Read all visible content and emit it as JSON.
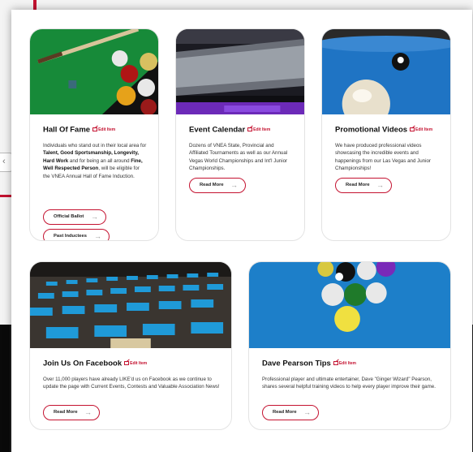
{
  "background": {
    "tab_glyph": "‹"
  },
  "cards": [
    {
      "title": "Hall Of Fame",
      "edit_label": "Edit Item",
      "text_parts": [
        {
          "t": "Individuals who stand out in their local area for ",
          "b": false
        },
        {
          "t": "Talent, Good Sportsmanship, Longevity, Hard Work",
          "b": true
        },
        {
          "t": " and for being an all around ",
          "b": false
        },
        {
          "t": "Fine, Well Respected Person",
          "b": true
        },
        {
          "t": ", will be eligible for the VNEA Annual Hall of Fame Induction.",
          "b": false
        }
      ],
      "buttons": [
        "Official Ballot",
        "Past Inductees"
      ]
    },
    {
      "title": "Event Calendar",
      "edit_label": "Edit Item",
      "text": "Dozens of VNEA State, Provincial and Affiliated Tournaments as well as our Annual Vegas World Championships and Int'l Junior Championships.",
      "buttons": [
        "Read More"
      ]
    },
    {
      "title": "Promotional Videos",
      "edit_label": "Edit Item",
      "text": "We have produced professional videos showcasing the incredible events and happenings from our Las Vegas and Junior Championships!",
      "buttons": [
        "Read More"
      ]
    },
    {
      "title": "Join Us On Facebook",
      "edit_label": "Edit Item",
      "text": "Over 11,000 players have already LIKE'd us on Facebook as we continue to update the page with Current Events, Contests and Valuable Association News!",
      "buttons": [
        "Read More"
      ]
    },
    {
      "title": "Dave Pearson Tips",
      "edit_label": "Edit Item",
      "text": "Professional player and ultimate entertainer, Dave \"Ginger Wizard\" Pearson, shares several helpful training videos to help every player improve their game.",
      "buttons": [
        "Read More"
      ]
    }
  ],
  "icons": {
    "arrow": "→"
  },
  "colors": {
    "accent": "#c41230",
    "felt_green": "#1a8a3a",
    "felt_blue": "#1f78c8"
  }
}
